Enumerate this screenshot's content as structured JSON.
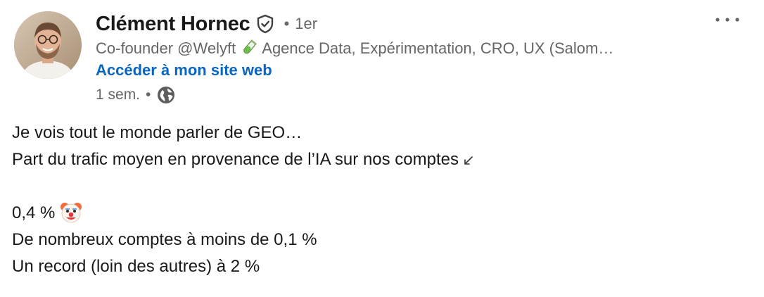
{
  "author": {
    "name": "Clément Hornec",
    "degree": "1er",
    "separator": "•",
    "headline_before": "Co-founder @Welyft",
    "headline_after": "Agence Data, Expérimentation, CRO, UX (Salom…",
    "website_link": "Accéder à mon site web",
    "time_ago": "1 sem.",
    "visibility_icon": "globe-icon",
    "verified_icon": "verified-shield-icon"
  },
  "menu": {
    "more_icon": "more-horizontal-icon"
  },
  "post": {
    "lines": [
      "Je vois tout le monde parler de GEO…",
      "Part du trafic moyen en provenance de l’IA sur nos comptes",
      "",
      "0,4 %",
      "De nombreux comptes à moins de 0,1 %",
      "Un record (loin des autres) à 2 %"
    ],
    "line2_icon": "arrow-down-left-icon",
    "line4_icon": "clown-face-icon"
  },
  "colors": {
    "link": "#0a66c2",
    "secondary_text": "#666666",
    "primary_text": "#191919"
  }
}
